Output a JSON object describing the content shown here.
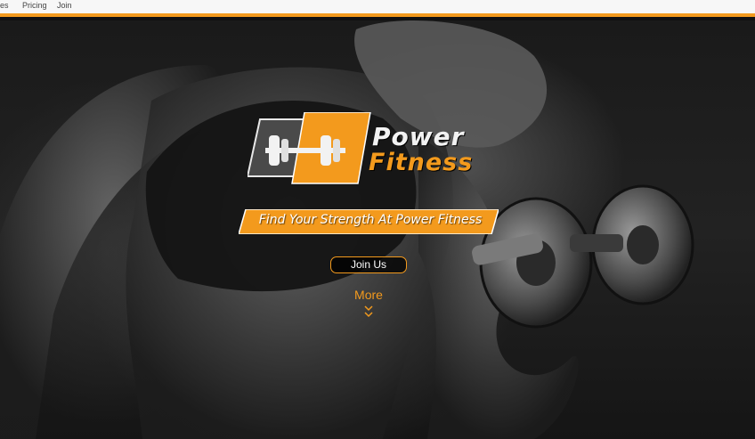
{
  "nav": {
    "items": [
      {
        "label": "es"
      },
      {
        "label": "Pricing"
      },
      {
        "label": "Join"
      }
    ]
  },
  "colors": {
    "accent": "#f39a1d",
    "nav_bg": "#f7f7f7",
    "hero_bg": "#1a1a1a"
  },
  "logo": {
    "line1": "Power",
    "line2": "Fitness",
    "icon": "barbell-icon"
  },
  "hero": {
    "tagline": "Find Your Strength At Power Fitness",
    "join_label": "Join Us",
    "more_label": "More",
    "more_icon": "double-chevron-down-icon"
  }
}
